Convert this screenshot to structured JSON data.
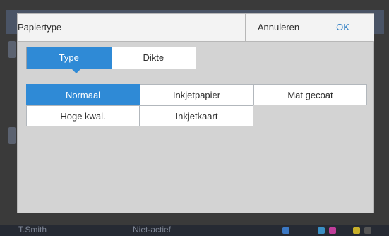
{
  "background": {
    "user_name": "T.Smith",
    "status": "Niet-actief"
  },
  "dialog": {
    "title": "Papiertype",
    "cancel_label": "Annuleren",
    "ok_label": "OK"
  },
  "tabs": [
    {
      "label": "Type",
      "active": true
    },
    {
      "label": "Dikte",
      "active": false
    }
  ],
  "options": [
    {
      "label": "Normaal",
      "selected": true
    },
    {
      "label": "Inkjetpapier",
      "selected": false
    },
    {
      "label": "Mat gecoat",
      "selected": false
    },
    {
      "label": "Hoge kwal.",
      "selected": false
    },
    {
      "label": "Inkjetkaart",
      "selected": false
    }
  ],
  "colors": {
    "accent": "#2f8ad6",
    "ok_text": "#2f7fc4",
    "dialog_body": "#d3d3d3",
    "header_bg": "#f3f3f3"
  }
}
